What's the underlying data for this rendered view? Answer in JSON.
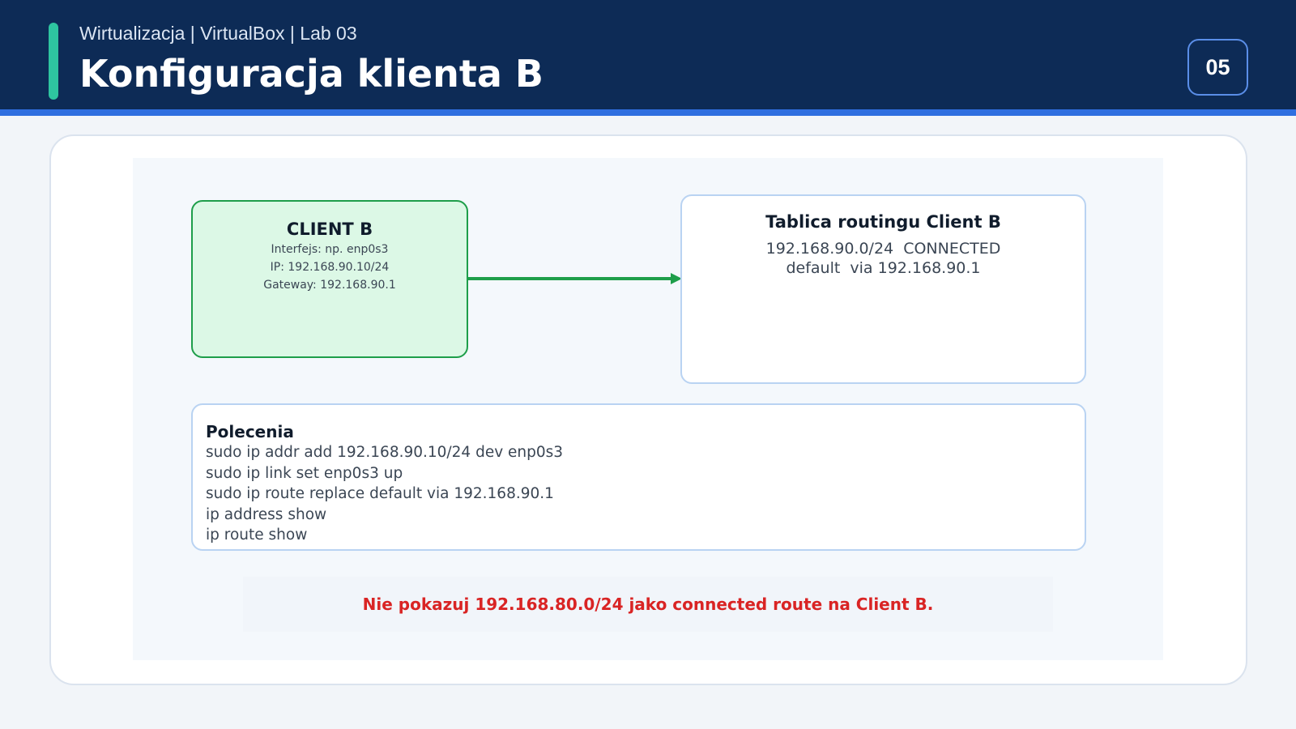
{
  "header": {
    "subtitle": "Wirtualizacja | VirtualBox | Lab 03",
    "title": "Konfiguracja klienta B",
    "page_number": "05"
  },
  "colors": {
    "header_bg": "#0d2b56",
    "header_accent": "#2ec4a0",
    "header_underline": "#2f6fe0",
    "client_fill": "#dcf8e6",
    "client_border": "#1e9e4a",
    "arrow": "#1e9e4a",
    "box_border": "#b9d3f2",
    "warning": "#d92424"
  },
  "diagram": {
    "client": {
      "title": "CLIENT B",
      "lines": [
        "Interfejs: np. enp0s3",
        "IP: 192.168.90.10/24",
        "Gateway: 192.168.90.1"
      ]
    },
    "routing_table": {
      "title": "Tablica routingu Client B",
      "lines": [
        "192.168.90.0/24  CONNECTED",
        "default  via 192.168.90.1"
      ]
    },
    "commands": {
      "title": "Polecenia",
      "lines": [
        "sudo ip addr add 192.168.90.10/24 dev enp0s3",
        "sudo ip link set enp0s3 up",
        "sudo ip route replace default via 192.168.90.1",
        "ip address show",
        "ip route show"
      ]
    },
    "warning": "Nie pokazuj 192.168.80.0/24 jako connected route na Client B."
  }
}
